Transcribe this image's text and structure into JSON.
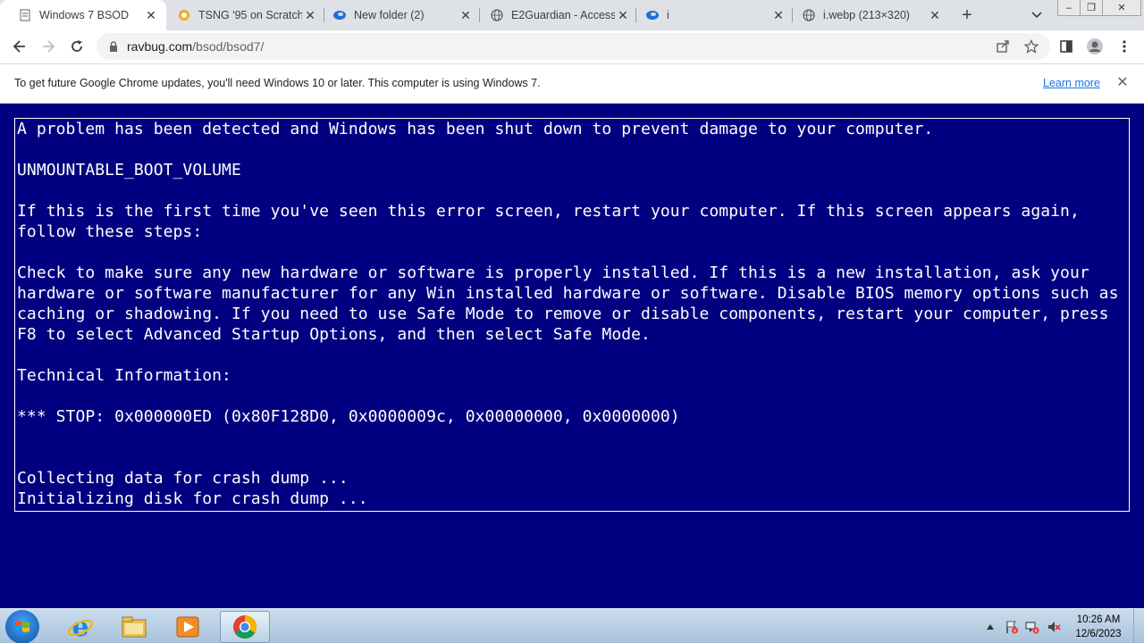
{
  "browser": {
    "tabs": [
      {
        "title": "Windows 7 BSOD",
        "icon": "page-icon",
        "active": true
      },
      {
        "title": "TSNG '95 on Scratch",
        "icon": "scratch-icon",
        "active": false
      },
      {
        "title": "New folder (2)",
        "icon": "edge-swirl-icon",
        "active": false
      },
      {
        "title": "E2Guardian - Access",
        "icon": "globe-icon",
        "active": false
      },
      {
        "title": "i",
        "icon": "edge-swirl-icon",
        "active": false
      },
      {
        "title": "i.webp (213×320)",
        "icon": "globe-icon",
        "active": false
      }
    ],
    "url_host": "ravbug.com",
    "url_path": "/bsod/bsod7/"
  },
  "infobar": {
    "message": "To get future Google Chrome updates, you'll need Windows 10 or later. This computer is using Windows 7.",
    "link": "Learn more"
  },
  "bsod": {
    "lines": [
      "A problem has been detected and Windows has been shut down to prevent damage to your computer.",
      "",
      "UNMOUNTABLE_BOOT_VOLUME",
      "",
      "If this is the first time you've seen this error screen, restart your computer. If this screen appears again,",
      "follow these steps:",
      "",
      "Check to make sure any new hardware or software is properly installed. If this is a new installation, ask your",
      "hardware or software manufacturer for any Win installed hardware or software. Disable BIOS memory options such as",
      "caching or shadowing. If you need to use Safe Mode to remove or disable components, restart your computer, press",
      "F8 to select Advanced Startup Options, and then select Safe Mode.",
      "",
      "Technical Information:",
      "",
      "*** STOP: 0x000000ED (0x80F128D0, 0x0000009c, 0x00000000, 0x0000000)",
      "",
      "",
      "Collecting data for crash dump ...",
      "Initializing disk for crash dump ..."
    ],
    "bg_color": "#000080",
    "text_color": "#ffffff"
  },
  "taskbar": {
    "apps": [
      "internet-explorer-icon",
      "file-explorer-icon",
      "media-player-icon",
      "chrome-icon"
    ],
    "time": "10:26 AM",
    "date": "12/6/2023"
  }
}
